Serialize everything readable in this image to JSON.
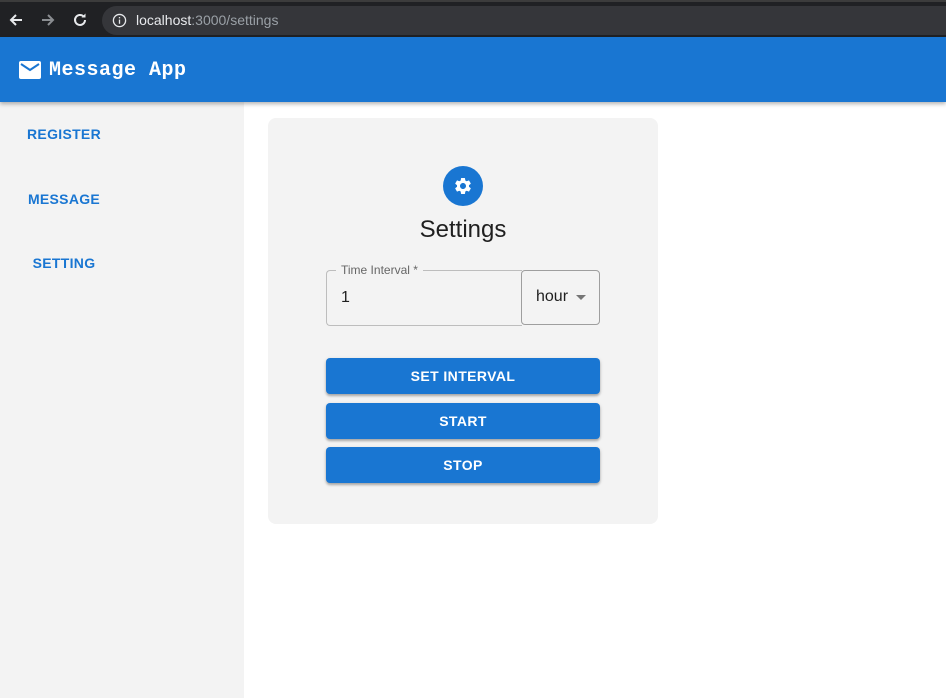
{
  "browser": {
    "url_host": "localhost",
    "url_path": ":3000/settings",
    "back_icon": "arrow-left-icon",
    "forward_icon": "arrow-right-icon",
    "reload_icon": "reload-icon",
    "info_icon": "info-icon"
  },
  "app_bar": {
    "title": "Message App",
    "logo_icon": "mail-icon",
    "color": "#1976d2"
  },
  "sidebar": {
    "items": [
      {
        "label": "REGISTER"
      },
      {
        "label": "MESSAGE"
      },
      {
        "label": "SETTING"
      }
    ]
  },
  "settings_card": {
    "icon": "gear-icon",
    "title": "Settings",
    "interval_field": {
      "label": "Time Interval *",
      "value": "1"
    },
    "unit_select": {
      "value": "hour"
    },
    "buttons": {
      "set_interval": "SET INTERVAL",
      "start": "START",
      "stop": "STOP"
    }
  }
}
